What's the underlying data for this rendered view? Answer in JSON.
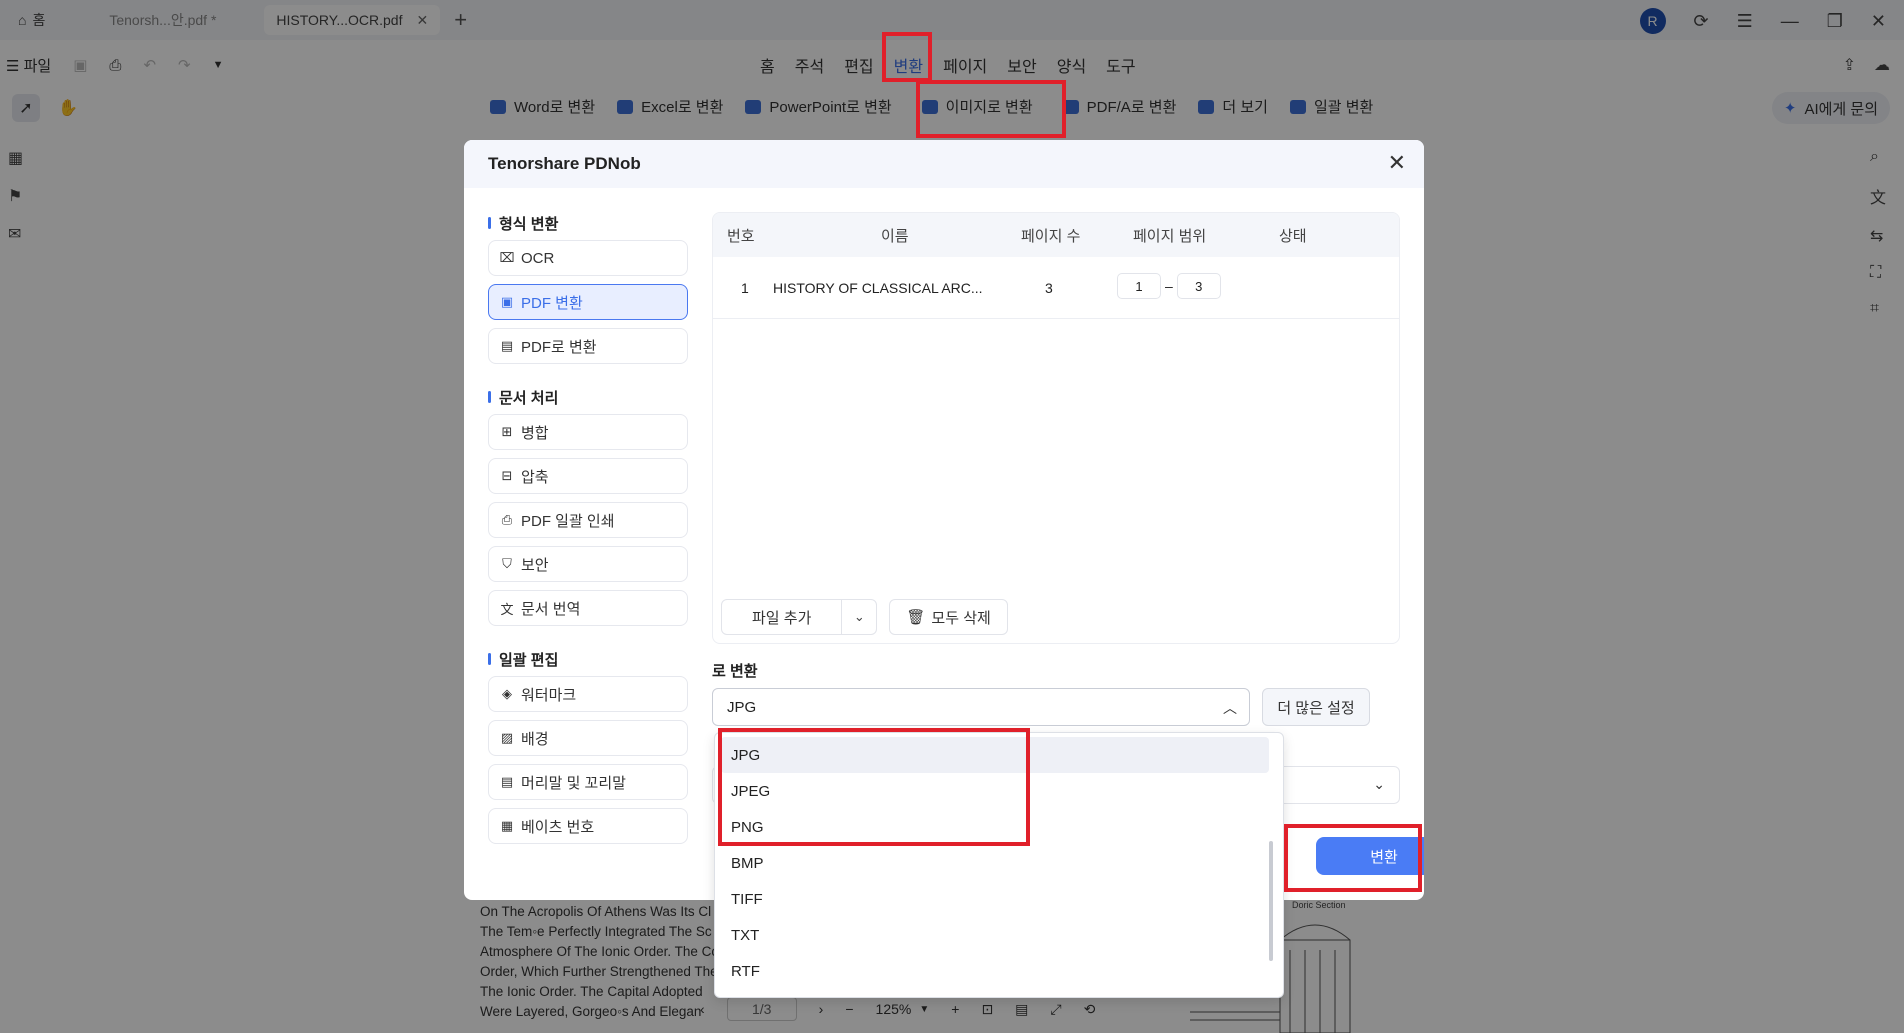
{
  "tabs": {
    "home": "홈",
    "tab1": "Tenorsh...안.pdf *",
    "tab2": "HISTORY...OCR.pdf",
    "avatar": "R"
  },
  "menubar": {
    "file": "파일",
    "items": [
      "홈",
      "주석",
      "편집",
      "변환",
      "페이지",
      "보안",
      "양식",
      "도구"
    ],
    "selected": "변환"
  },
  "convert_toolbar": {
    "word": "Word로 변환",
    "excel": "Excel로 변환",
    "ppt": "PowerPoint로 변환",
    "image": "이미지로 변환",
    "pdfa": "PDF/A로 변환",
    "more": "더 보기",
    "batch": "일괄 변환",
    "ai": "AI에게 문의"
  },
  "dialog": {
    "title": "Tenorshare PDNob",
    "sections": {
      "format": "형식 변환",
      "doc": "문서 처리",
      "batch": "일괄 편집"
    },
    "format_items": [
      "OCR",
      "PDF 변환",
      "PDF로 변환"
    ],
    "doc_items": [
      "병합",
      "압축",
      "PDF 일괄 인쇄",
      "보안",
      "문서 번역"
    ],
    "batch_items": [
      "워터마크",
      "배경",
      "머리말 및 꼬리말",
      "베이츠 번호"
    ],
    "table": {
      "headers": [
        "번호",
        "이름",
        "페이지 수",
        "페이지 범위",
        "상태"
      ],
      "rows": [
        {
          "no": "1",
          "name": "HISTORY OF CLASSICAL ARC...",
          "pages": "3",
          "from": "1",
          "to": "3",
          "status": ""
        }
      ]
    },
    "add_file": "파일 추가",
    "delete_all": "모두 삭제",
    "to_label": "로 변환",
    "selected_format": "JPG",
    "more_settings": "더 많은 설정",
    "convert": "변환"
  },
  "dropdown_options": [
    "JPG",
    "JPEG",
    "PNG",
    "BMP",
    "TIFF",
    "TXT",
    "RTF"
  ],
  "document": {
    "lines": [
      "On The Acropolis Of Athens Was Its Cl",
      "The Tem◦e Perfectly Integrated The Sc",
      "Atmosphere Of The Ionic Order. The Co",
      "Order, Which Further Strengthened The",
      "The Ionic Order. The Capital Adopted",
      "Were Layered, Gorgeo◦s And Elegan"
    ],
    "figure_label": "Doric Section",
    "page": "1/3",
    "zoom": "125%"
  },
  "colors": {
    "accent": "#3b6fe8",
    "highlight": "#e0202a",
    "convert_button": "#4a7cf5"
  }
}
